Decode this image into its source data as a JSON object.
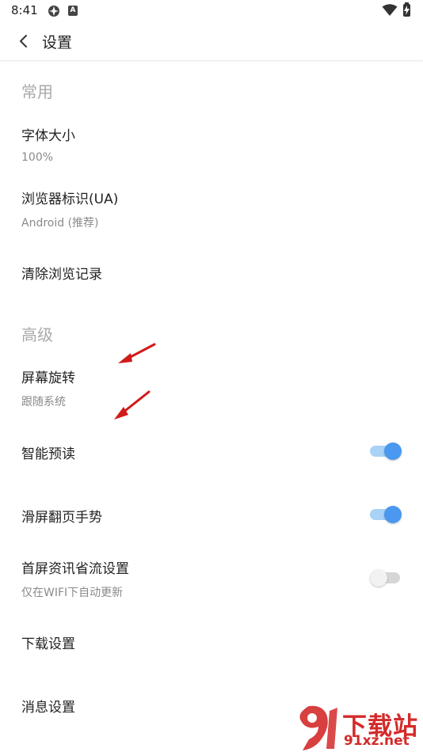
{
  "status_bar": {
    "time": "8:41",
    "notif_badge": "A"
  },
  "toolbar": {
    "title": "设置"
  },
  "sections": {
    "common": {
      "header": "常用",
      "font_size": {
        "title": "字体大小",
        "value": "100%"
      },
      "user_agent": {
        "title": "浏览器标识(UA)",
        "value": "Android (推荐)"
      },
      "clear_history": {
        "title": "清除浏览记录"
      }
    },
    "advanced": {
      "header": "高级",
      "rotation": {
        "title": "屏幕旋转",
        "value": "跟随系统"
      },
      "smart_preload": {
        "title": "智能预读",
        "enabled": true
      },
      "swipe_gesture": {
        "title": "滑屏翻页手势",
        "enabled": true
      },
      "data_saver": {
        "title": "首屏资讯省流设置",
        "subtitle": "仅在WIFI下自动更新",
        "enabled": false
      },
      "download_settings": {
        "title": "下载设置"
      },
      "message_settings": {
        "title": "消息设置"
      }
    }
  },
  "annotations": {
    "arrow_color": "#d11a1a"
  },
  "watermark": {
    "brand_text": "下载站",
    "domain": "91xz.net"
  },
  "colors": {
    "accent": "#4a98ef",
    "section_header": "#a9a9a9"
  }
}
